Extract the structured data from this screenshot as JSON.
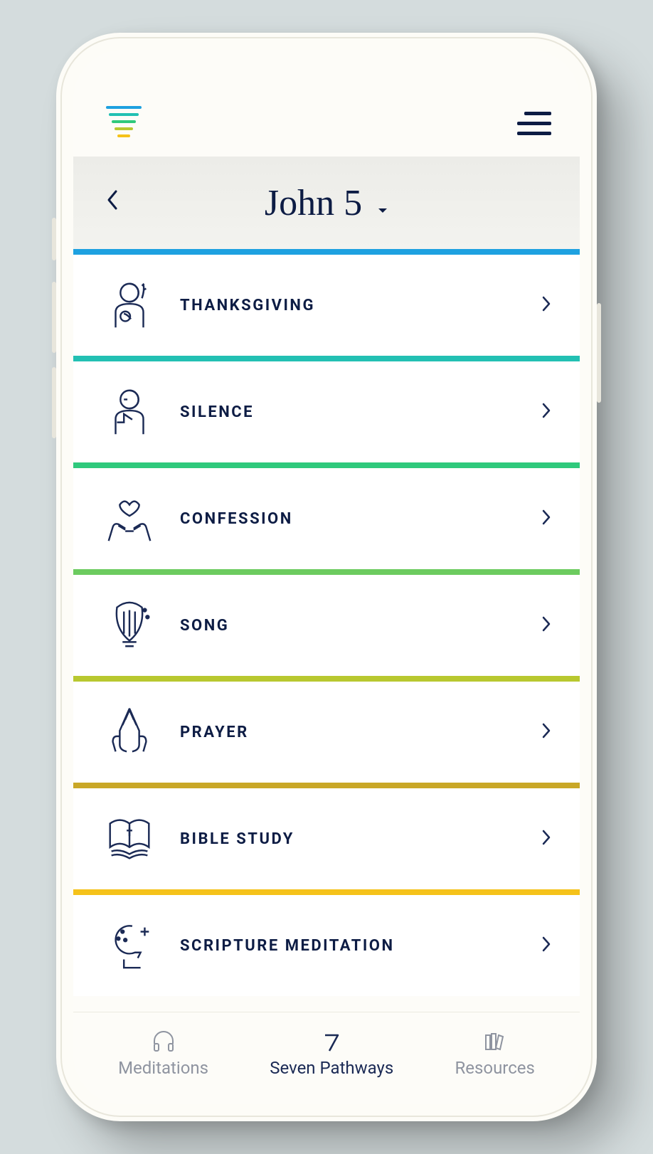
{
  "header": {
    "title": "John 5"
  },
  "pathways": [
    {
      "label": "THANKSGIVING",
      "color": "#1ea1e0",
      "icon": "thanksgiving"
    },
    {
      "label": "SILENCE",
      "color": "#22c0b3",
      "icon": "silence"
    },
    {
      "label": "CONFESSION",
      "color": "#2fc97c",
      "icon": "confession"
    },
    {
      "label": "SONG",
      "color": "#6ccb5f",
      "icon": "song"
    },
    {
      "label": "PRAYER",
      "color": "#b8c82f",
      "icon": "prayer"
    },
    {
      "label": "BIBLE STUDY",
      "color": "#c9a727",
      "icon": "bible-study"
    },
    {
      "label": "SCRIPTURE MEDITATION",
      "color": "#f5c21a",
      "icon": "scripture-meditation"
    }
  ],
  "bottom_nav": [
    {
      "label": "Meditations",
      "icon": "headphones",
      "active": false
    },
    {
      "label": "Seven Pathways",
      "icon": "seven",
      "active": true
    },
    {
      "label": "Resources",
      "icon": "books",
      "active": false
    }
  ]
}
